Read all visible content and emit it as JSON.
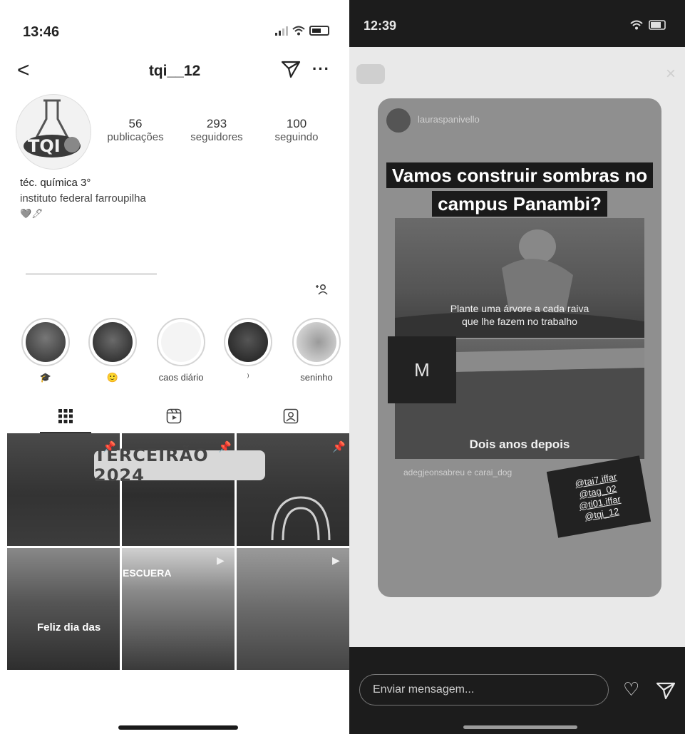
{
  "left": {
    "status": {
      "time": "13:46"
    },
    "header": {
      "username": "tqi__12",
      "back": "<",
      "more": "···"
    },
    "stats": [
      {
        "value": "56",
        "label": "publicações"
      },
      {
        "value": "293",
        "label": "seguidores"
      },
      {
        "value": "100",
        "label": "seguindo"
      }
    ],
    "bio": {
      "name": "téc. química 3°",
      "line": "instituto federal farroupilha",
      "emoji": "🩶🖊"
    },
    "add_friend": "+𐀪",
    "highlights": [
      {
        "label": "🎓",
        "color": "#555555"
      },
      {
        "label": "🙂",
        "color": "#444444"
      },
      {
        "label": "caos diário",
        "color": "#f2f2f2"
      },
      {
        "label": "⁾",
        "color": "#3a3a3a"
      },
      {
        "label": "seninho",
        "color": "#bdbdbd"
      }
    ],
    "grid": {
      "banner": "TERCEIRÃO 2024",
      "feliz": "Feliz dia das",
      "escuera": "ESCUERA"
    }
  },
  "right": {
    "status": {
      "time": "12:39"
    },
    "story": {
      "username": "lauraspanivello",
      "title_line1": "Vamos construir sombras no",
      "title_line2": "campus Panambi?",
      "photo1_caption_line1": "Plante uma árvore a cada raiva",
      "photo1_caption_line2": "que lhe fazem no trabalho",
      "m_letter": "M",
      "photo2_caption": "Dois anos depois",
      "mention": "adegjeonsabreu e carai_dog",
      "tags": [
        "@tai7.iffar",
        "@tag_02",
        "@ti01.iffar",
        "@tqi_12"
      ]
    },
    "message_placeholder": "Enviar mensagem..."
  },
  "icons": {
    "heart": "♡",
    "close": "×"
  }
}
